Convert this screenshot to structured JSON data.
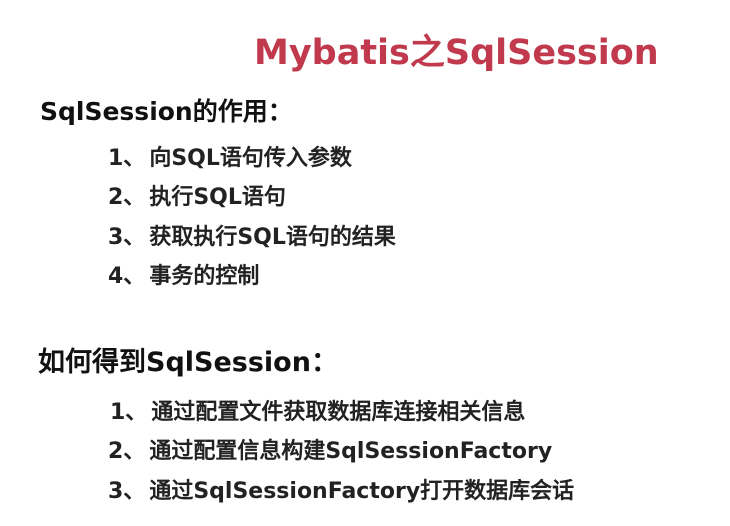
{
  "slide": {
    "title": "Mybatis之SqlSession",
    "section1": {
      "heading": "SqlSession的作用：",
      "items": [
        {
          "num": "1、",
          "text": "向SQL语句传入参数"
        },
        {
          "num": "2、",
          "text": "执行SQL语句"
        },
        {
          "num": "3、",
          "text": "获取执行SQL语句的结果"
        },
        {
          "num": "4、",
          "text": "事务的控制"
        }
      ]
    },
    "section2": {
      "heading": "如何得到SqlSession：",
      "items": [
        {
          "num": "1、",
          "text": "通过配置文件获取数据库连接相关信息"
        },
        {
          "num": "2、",
          "text": "通过配置信息构建SqlSessionFactory"
        },
        {
          "num": "3、",
          "text": "通过SqlSessionFactory打开数据库会话"
        }
      ]
    }
  }
}
